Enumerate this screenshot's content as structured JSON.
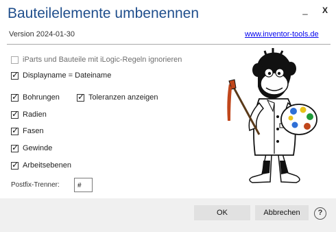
{
  "window": {
    "title": "Bauteilelemente umbenennen",
    "minimize_label": "_",
    "close_label": "X"
  },
  "header": {
    "version": "Version 2024-01-30",
    "link": "www.inventor-tools.de"
  },
  "options": {
    "ignore_ilogic": {
      "label": "iParts und Bauteile mit iLogic-Regeln ignorieren",
      "checked": false,
      "enabled": false
    },
    "displayname": {
      "label": "Displayname = Dateiname",
      "checked": true
    },
    "bohrungen": {
      "label": "Bohrungen",
      "checked": true
    },
    "toleranzen": {
      "label": "Toleranzen anzeigen",
      "checked": true
    },
    "radien": {
      "label": "Radien",
      "checked": true
    },
    "fasen": {
      "label": "Fasen",
      "checked": true
    },
    "gewinde": {
      "label": "Gewinde",
      "checked": true
    },
    "arbeitsebenen": {
      "label": "Arbeitsebenen",
      "checked": true
    }
  },
  "postfix": {
    "label": "Postfix-Trenner:",
    "value": "#"
  },
  "footer": {
    "ok_label": "OK",
    "cancel_label": "Abbrechen",
    "help_label": "?"
  },
  "colors": {
    "title": "#1f4e8c",
    "link": "#0000ee",
    "footer_bg": "#f0f0f0",
    "button_bg": "#e1e1e1"
  },
  "icons": {
    "check": "checkmark-icon",
    "mascot": "monkey-painter-illustration",
    "help": "help-icon"
  }
}
